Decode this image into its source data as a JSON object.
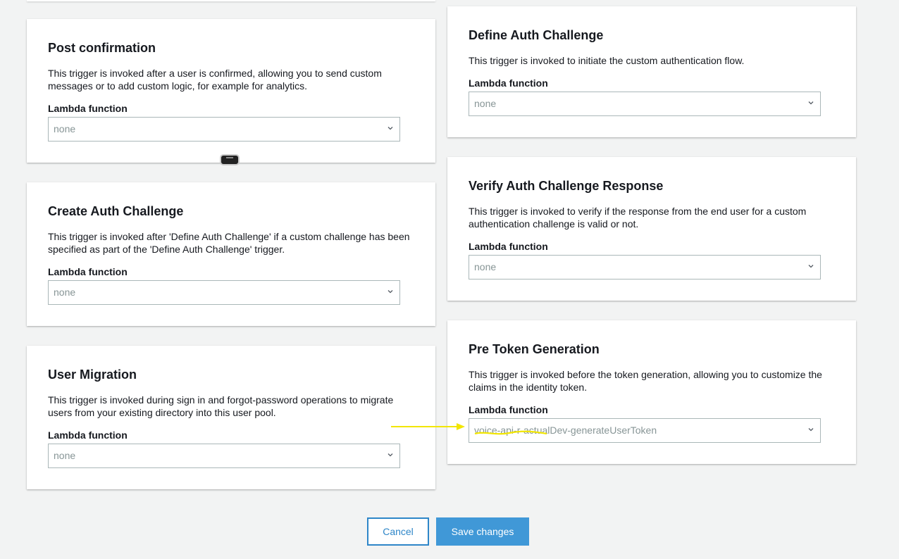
{
  "cards": {
    "post_confirmation": {
      "title": "Post confirmation",
      "description": "This trigger is invoked after a user is confirmed, allowing you to send custom messages or to add custom logic, for example for analytics.",
      "lambda_label": "Lambda function",
      "lambda_value": "none"
    },
    "define_auth": {
      "title": "Define Auth Challenge",
      "description": "This trigger is invoked to initiate the custom authentication flow.",
      "lambda_label": "Lambda function",
      "lambda_value": "none"
    },
    "create_auth": {
      "title": "Create Auth Challenge",
      "description": "This trigger is invoked after 'Define Auth Challenge' if a custom challenge has been specified as part of the 'Define Auth Challenge' trigger.",
      "lambda_label": "Lambda function",
      "lambda_value": "none"
    },
    "verify_auth": {
      "title": "Verify Auth Challenge Response",
      "description": "This trigger is invoked to verify if the response from the end user for a custom authentication challenge is valid or not.",
      "lambda_label": "Lambda function",
      "lambda_value": "none"
    },
    "user_migration": {
      "title": "User Migration",
      "description": "This trigger is invoked during sign in and forgot-password operations to migrate users from your existing directory into this user pool.",
      "lambda_label": "Lambda function",
      "lambda_value": "none"
    },
    "pre_token": {
      "title": "Pre Token Generation",
      "description": "This trigger is invoked before the token generation, allowing you to customize the claims in the identity token.",
      "lambda_label": "Lambda function",
      "lambda_value_redacted": "voice-api-r-actual",
      "lambda_value_rest": "Dev-generateUserToken"
    }
  },
  "buttons": {
    "cancel": "Cancel",
    "save": "Save changes"
  },
  "colors": {
    "primary": "#4098d7",
    "link": "#2e86c8",
    "annotation": "#f2e600",
    "background": "#f2f3f3"
  },
  "icons": [
    "chevron-down-icon",
    "annotation-arrow-icon"
  ]
}
